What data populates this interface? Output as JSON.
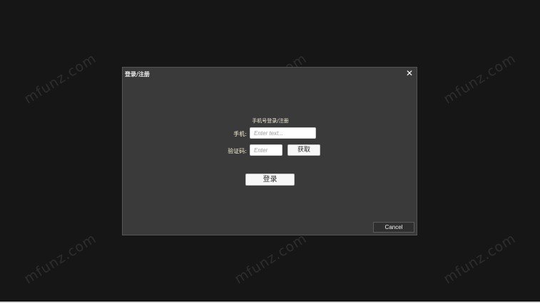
{
  "watermark": {
    "text": "mfunz.com"
  },
  "dialog": {
    "title": "登录/注册",
    "close_glyph": "✕",
    "heading": "手机号登录/注册",
    "phone_label": "手机:",
    "phone_placeholder": "Enter text...",
    "code_label": "验证码:",
    "code_placeholder": "Enter",
    "get_code_label": "获取",
    "login_label": "登录",
    "cancel_label": "Cancel"
  },
  "colors": {
    "background": "#161616",
    "dialog": "#3a3a3a",
    "label_text": "#f6f1d2"
  },
  "icons": {
    "close": "close-icon"
  }
}
